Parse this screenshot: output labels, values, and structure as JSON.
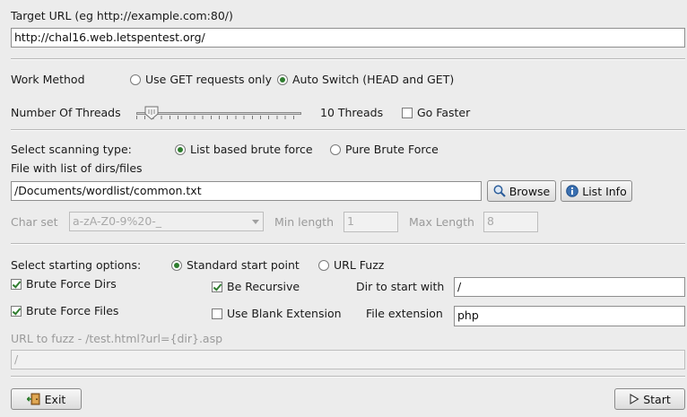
{
  "target": {
    "label": "Target URL (eg http://example.com:80/)",
    "value": "http://chal16.web.letspentest.org/"
  },
  "work_method": {
    "label": "Work Method",
    "options": [
      "Use GET requests only",
      "Auto Switch (HEAD and GET)"
    ],
    "selected": "Auto Switch (HEAD and GET)"
  },
  "threads": {
    "label": "Number Of Threads",
    "value_text": "10 Threads",
    "go_faster_label": "Go Faster",
    "go_faster_checked": false
  },
  "scan_type": {
    "label": "Select scanning type:",
    "options": [
      "List based brute force",
      "Pure Brute Force"
    ],
    "selected": "List based brute force",
    "file_label": "File with list of dirs/files",
    "file_value": "/Documents/wordlist/common.txt",
    "browse_label": "Browse",
    "list_info_label": "List Info"
  },
  "charset": {
    "label": "Char set",
    "value": "a-zA-Z0-9%20-_",
    "min_label": "Min length",
    "min_value": "1",
    "max_label": "Max Length",
    "max_value": "8"
  },
  "start_options": {
    "label": "Select starting options:",
    "options": [
      "Standard start point",
      "URL Fuzz"
    ],
    "selected": "Standard start point",
    "brute_dirs_label": "Brute Force Dirs",
    "brute_files_label": "Brute Force Files",
    "recursive_label": "Be Recursive",
    "blank_ext_label": "Use Blank Extension",
    "dir_start_label": "Dir to start with",
    "dir_start_value": "/",
    "file_ext_label": "File extension",
    "file_ext_value": "php"
  },
  "fuzz": {
    "label": "URL to fuzz - /test.html?url={dir}.asp",
    "value": "/"
  },
  "footer": {
    "exit_label": "Exit",
    "start_label": "Start"
  },
  "colors": {
    "background": "#ececec",
    "radio_on": "#2f7d2f",
    "disabled_text": "#9a9a9a"
  }
}
